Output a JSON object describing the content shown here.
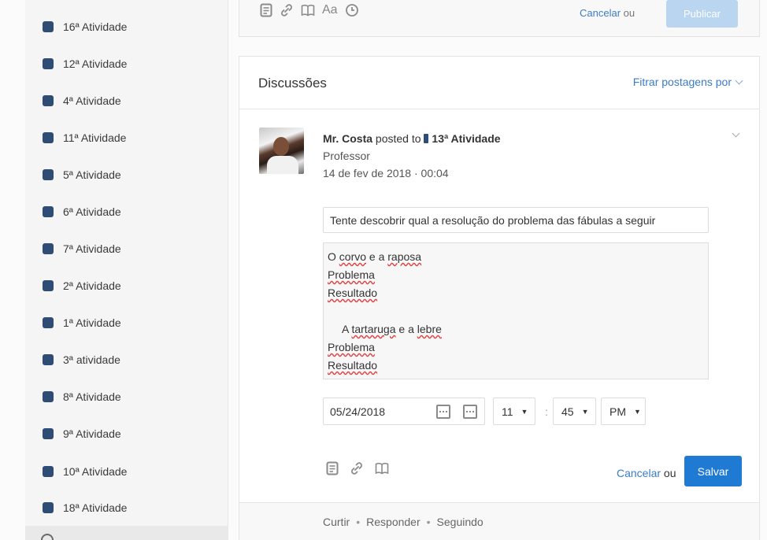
{
  "sidebar": {
    "items": [
      {
        "label": "16ª Atividade"
      },
      {
        "label": "12ª Atividade"
      },
      {
        "label": "4ª Atividade"
      },
      {
        "label": "11ª Atividade"
      },
      {
        "label": "5ª Atividade"
      },
      {
        "label": "6ª Atividade"
      },
      {
        "label": "7ª Atividade"
      },
      {
        "label": "2ª Atividade"
      },
      {
        "label": "1ª Atividade"
      },
      {
        "label": "3ª atividade"
      },
      {
        "label": "8ª Atividade"
      },
      {
        "label": "9ª Atividade"
      },
      {
        "label": "10ª Atividade"
      },
      {
        "label": "18ª Atividade"
      }
    ],
    "item_color": "#2f4d74"
  },
  "composer": {
    "format_label": "Aa",
    "cancel": "Cancelar",
    "or": "ou",
    "publish": "Publicar"
  },
  "discussions": {
    "title": "Discussões",
    "filter": "Fitrar postagens por",
    "post": {
      "author": "Mr. Costa",
      "posted_to": "posted to",
      "topic": "13ª Atividade",
      "role": "Professor",
      "date": "14 de fev de 2018 · 00:04",
      "title_value": "Tente descobrir qual a resolução do problema das fábulas a seguir",
      "body": {
        "l1_a": "O ",
        "l1_b": "corvo",
        "l1_c": " e a ",
        "l1_d": "raposa",
        "l2": "Problema",
        "l3": "Resultado",
        "l4_a": "A ",
        "l4_b": "tartaruga",
        "l4_c": " e a ",
        "l4_d": "lebre",
        "l5": "Problema",
        "l6": "Resultado"
      },
      "schedule_date": "05/24/2018",
      "hour": "11",
      "minute": "45",
      "ampm": "PM",
      "colon": ":",
      "cancel": "Cancelar",
      "or": "ou",
      "save": "Salvar"
    },
    "footer": {
      "like": "Curtir",
      "reply": "Responder",
      "following": "Seguindo",
      "sep": "•"
    }
  },
  "colors": {
    "accent": "#1e7ad3",
    "link": "#3b7bc8",
    "publish_disabled": "#b9d5f0"
  }
}
